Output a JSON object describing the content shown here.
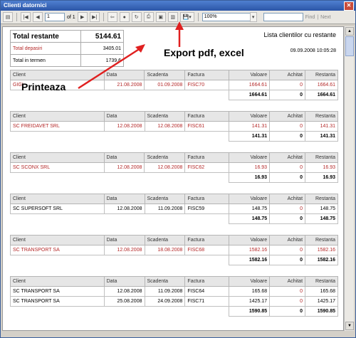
{
  "window": {
    "title": "Clienti datornici"
  },
  "toolbar": {
    "page_current": "1",
    "page_of": "of 1",
    "zoom": "100%",
    "find": "Find",
    "pipe": "|",
    "next": "Next"
  },
  "summary": {
    "total_restante_label": "Total restante",
    "total_restante_value": "5144.61",
    "total_depasiri_label": "Total depasiri",
    "total_depasiri_value": "3405.01",
    "total_termen_label": "Total in termen",
    "total_termen_value": "1739.6"
  },
  "report": {
    "title": "Lista clientilor cu restante",
    "date": "09.09.2008 10:05:28"
  },
  "columns": [
    "Client",
    "Data",
    "Scadenta",
    "Factura",
    "Valoare",
    "Achitat",
    "Restanta"
  ],
  "groups": [
    {
      "rows": [
        {
          "client": "GIGI",
          "data": "21.08.2008",
          "scadenta": "01.09.2008",
          "factura": "FISC70",
          "valoare": "1664.61",
          "achitat": "0",
          "restanta": "1664.61",
          "overdue": true
        }
      ],
      "total": {
        "valoare": "1664.61",
        "achitat": "0",
        "restanta": "1664.61"
      }
    },
    {
      "rows": [
        {
          "client": "SC FREIDAVET SRL",
          "data": "12.08.2008",
          "scadenta": "12.08.2008",
          "factura": "FISC61",
          "valoare": "141.31",
          "achitat": "0",
          "restanta": "141.31",
          "overdue": true
        }
      ],
      "total": {
        "valoare": "141.31",
        "achitat": "0",
        "restanta": "141.31"
      }
    },
    {
      "rows": [
        {
          "client": "SC SCONX SRL",
          "data": "12.08.2008",
          "scadenta": "12.08.2008",
          "factura": "FISC62",
          "valoare": "16.93",
          "achitat": "0",
          "restanta": "16.93",
          "overdue": true
        }
      ],
      "total": {
        "valoare": "16.93",
        "achitat": "0",
        "restanta": "16.93"
      }
    },
    {
      "rows": [
        {
          "client": "SC SUPERSOFT SRL",
          "data": "12.08.2008",
          "scadenta": "11.09.2008",
          "factura": "FISC59",
          "valoare": "148.75",
          "achitat": "0",
          "restanta": "148.75",
          "overdue": false
        }
      ],
      "total": {
        "valoare": "148.75",
        "achitat": "0",
        "restanta": "148.75"
      }
    },
    {
      "rows": [
        {
          "client": "SC TRANSPORT SA",
          "data": "12.08.2008",
          "scadenta": "18.08.2008",
          "factura": "FISC68",
          "valoare": "1582.16",
          "achitat": "0",
          "restanta": "1582.16",
          "overdue": true
        }
      ],
      "total": {
        "valoare": "1582.16",
        "achitat": "0",
        "restanta": "1582.16"
      }
    },
    {
      "rows": [
        {
          "client": "SC TRANSPORT SA",
          "data": "12.08.2008",
          "scadenta": "11.09.2008",
          "factura": "FISC64",
          "valoare": "165.68",
          "achitat": "0",
          "restanta": "165.68",
          "overdue": false
        },
        {
          "client": "SC TRANSPORT SA",
          "data": "25.08.2008",
          "scadenta": "24.09.2008",
          "factura": "FISC71",
          "valoare": "1425.17",
          "achitat": "0",
          "restanta": "1425.17",
          "overdue": false
        }
      ],
      "total": {
        "valoare": "1590.85",
        "achitat": "0",
        "restanta": "1590.85"
      }
    }
  ],
  "annotations": {
    "print": "Printeaza",
    "export": "Export pdf, excel"
  },
  "colors": {
    "overdue_text": "#b42828",
    "annotation_arrow": "#e02020",
    "title_bar": "#2b55a6"
  }
}
